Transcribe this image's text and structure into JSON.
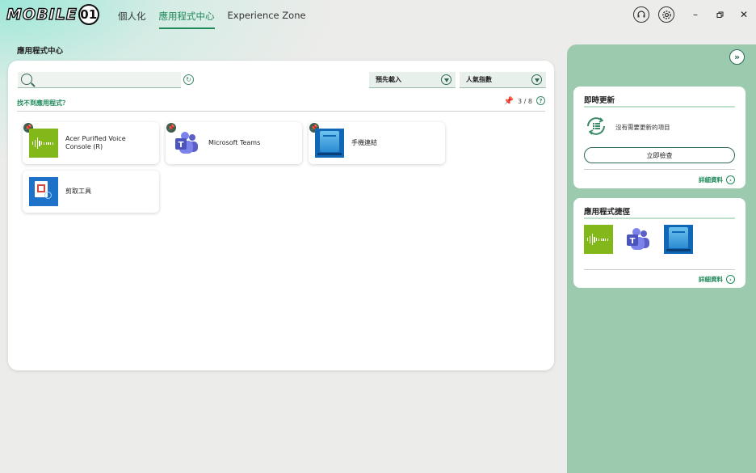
{
  "header": {
    "logo_text": "MOBILE",
    "logo_e": "01",
    "tabs": [
      {
        "label": "個人化"
      },
      {
        "label": "應用程式中心"
      },
      {
        "label": "Experience Zone"
      }
    ],
    "icons": [
      "headset-icon",
      "settings-icon",
      "minimize-icon",
      "restore-icon",
      "close-icon"
    ]
  },
  "page_title": "應用程式中心",
  "toolbar": {
    "search_placeholder": "",
    "preload_label": "預先載入",
    "popularity_label": "人氣指數",
    "help_link": "找不到應用程式？",
    "pin_count": "3 / 8",
    "help_q": "?"
  },
  "apps": [
    {
      "label": "Acer Purified Voice Console (R)",
      "pinned": true,
      "icon": "acer-purified-voice-icon"
    },
    {
      "label": "Microsoft Teams",
      "pinned": true,
      "icon": "teams-icon"
    },
    {
      "label": "手機連結",
      "pinned": true,
      "icon": "phone-link-icon"
    },
    {
      "label": "剪取工具",
      "pinned": false,
      "icon": "snipping-tool-icon"
    }
  ],
  "sidebar": {
    "update": {
      "title": "即時更新",
      "status": "沒有需要更新的項目",
      "button": "立即檢查",
      "detail": "詳細資料"
    },
    "shortcuts": {
      "title": "應用程式捷徑",
      "detail": "詳細資料"
    }
  },
  "colors": {
    "accent": "#1f8a5a",
    "panel_green": "#9ccaaf",
    "acer_green": "#83b81a",
    "phone_blue": "#0f67b5"
  }
}
